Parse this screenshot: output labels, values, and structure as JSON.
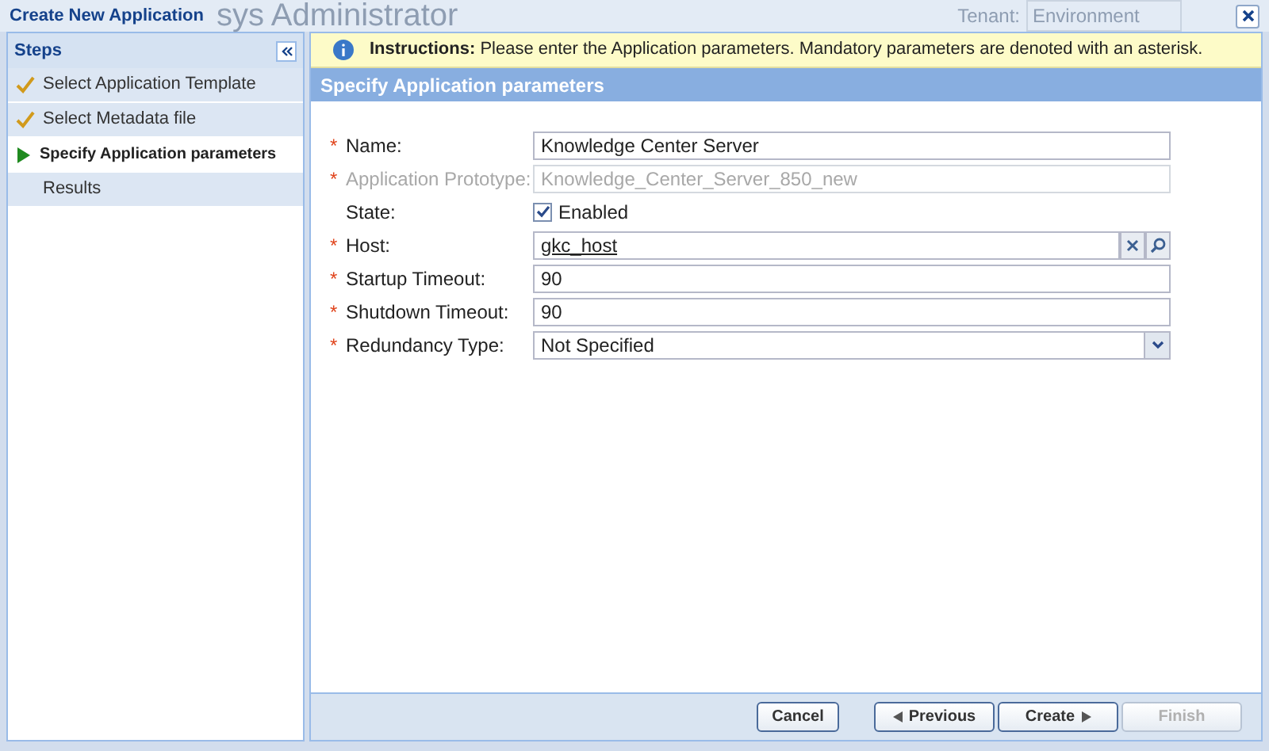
{
  "window": {
    "title": "Create New Application",
    "background_title": "sys Administrator",
    "tenant_label": "Tenant:",
    "tenant_value": "Environment"
  },
  "steps": {
    "title": "Steps",
    "items": [
      {
        "label": "Select Application Template",
        "kind": "done",
        "selected": false
      },
      {
        "label": "Select Metadata file",
        "kind": "done",
        "selected": false
      },
      {
        "label": "Specify Application parameters",
        "kind": "current",
        "selected": true
      },
      {
        "label": "Results",
        "kind": "pending",
        "selected": false
      }
    ]
  },
  "instructions": {
    "label": "Instructions:",
    "text": "Please enter the Application parameters. Mandatory parameters are denoted with an asterisk."
  },
  "section_title": "Specify Application parameters",
  "fields": [
    {
      "kind": "text",
      "marker": "*",
      "label": "Name:",
      "disabled": false,
      "value": "Knowledge Center Server"
    },
    {
      "kind": "text",
      "marker": "*",
      "label": "Application Prototype:",
      "disabled": true,
      "value": "Knowledge_Center_Server_850_new"
    },
    {
      "kind": "checkbox",
      "label": "State:",
      "checked": true,
      "option": "Enabled"
    },
    {
      "kind": "lookup",
      "marker": "*",
      "label": "Host:",
      "value": "gkc_host"
    },
    {
      "kind": "text",
      "marker": "*",
      "label": "Startup Timeout:",
      "disabled": false,
      "value": "90"
    },
    {
      "kind": "text",
      "marker": "*",
      "label": "Shutdown Timeout:",
      "disabled": false,
      "value": "90"
    },
    {
      "kind": "select",
      "marker": "*",
      "label": "Redundancy Type:",
      "value": "Not Specified"
    }
  ],
  "buttons": [
    {
      "label": "Cancel",
      "kind": "plain",
      "disabled": false
    },
    {
      "label": "Previous",
      "kind": "back",
      "disabled": false
    },
    {
      "label": "Create",
      "kind": "next",
      "disabled": false
    },
    {
      "label": "Finish",
      "kind": "plain",
      "disabled": true
    }
  ]
}
